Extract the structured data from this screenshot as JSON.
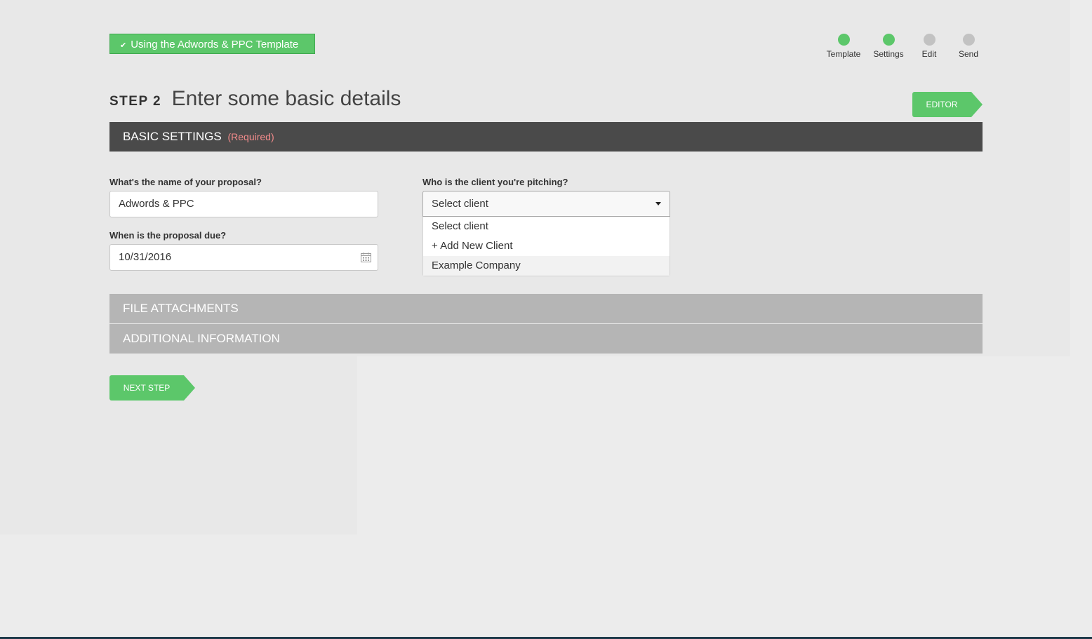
{
  "banner": {
    "text": "Using the Adwords & PPC Template",
    "check": "✔"
  },
  "progress": {
    "steps": [
      {
        "label": "Template",
        "done": true
      },
      {
        "label": "Settings",
        "done": true
      },
      {
        "label": "Edit",
        "done": false
      },
      {
        "label": "Send",
        "done": false
      }
    ]
  },
  "heading": {
    "step": "STEP 2",
    "title": "Enter some basic details"
  },
  "editor_button": "EDITOR",
  "basic_settings": {
    "title": "BASIC SETTINGS",
    "required": "(Required)"
  },
  "form": {
    "name_label": "What's the name of your proposal?",
    "name_value": "Adwords & PPC",
    "due_label": "When is the proposal due?",
    "due_value": "10/31/2016",
    "client_label": "Who is the client you're pitching?",
    "client_selected": "Select client",
    "client_options": [
      "Select client",
      "+ Add New Client",
      "Example Company"
    ]
  },
  "sections": {
    "files": "FILE ATTACHMENTS",
    "additional": "ADDITIONAL INFORMATION"
  },
  "next_button": "NEXT STEP",
  "colors": {
    "accent": "#5cc76a",
    "dark_bar": "#4a4a4a",
    "grey_bar": "#b5b5b5",
    "required": "#f28b8b"
  }
}
